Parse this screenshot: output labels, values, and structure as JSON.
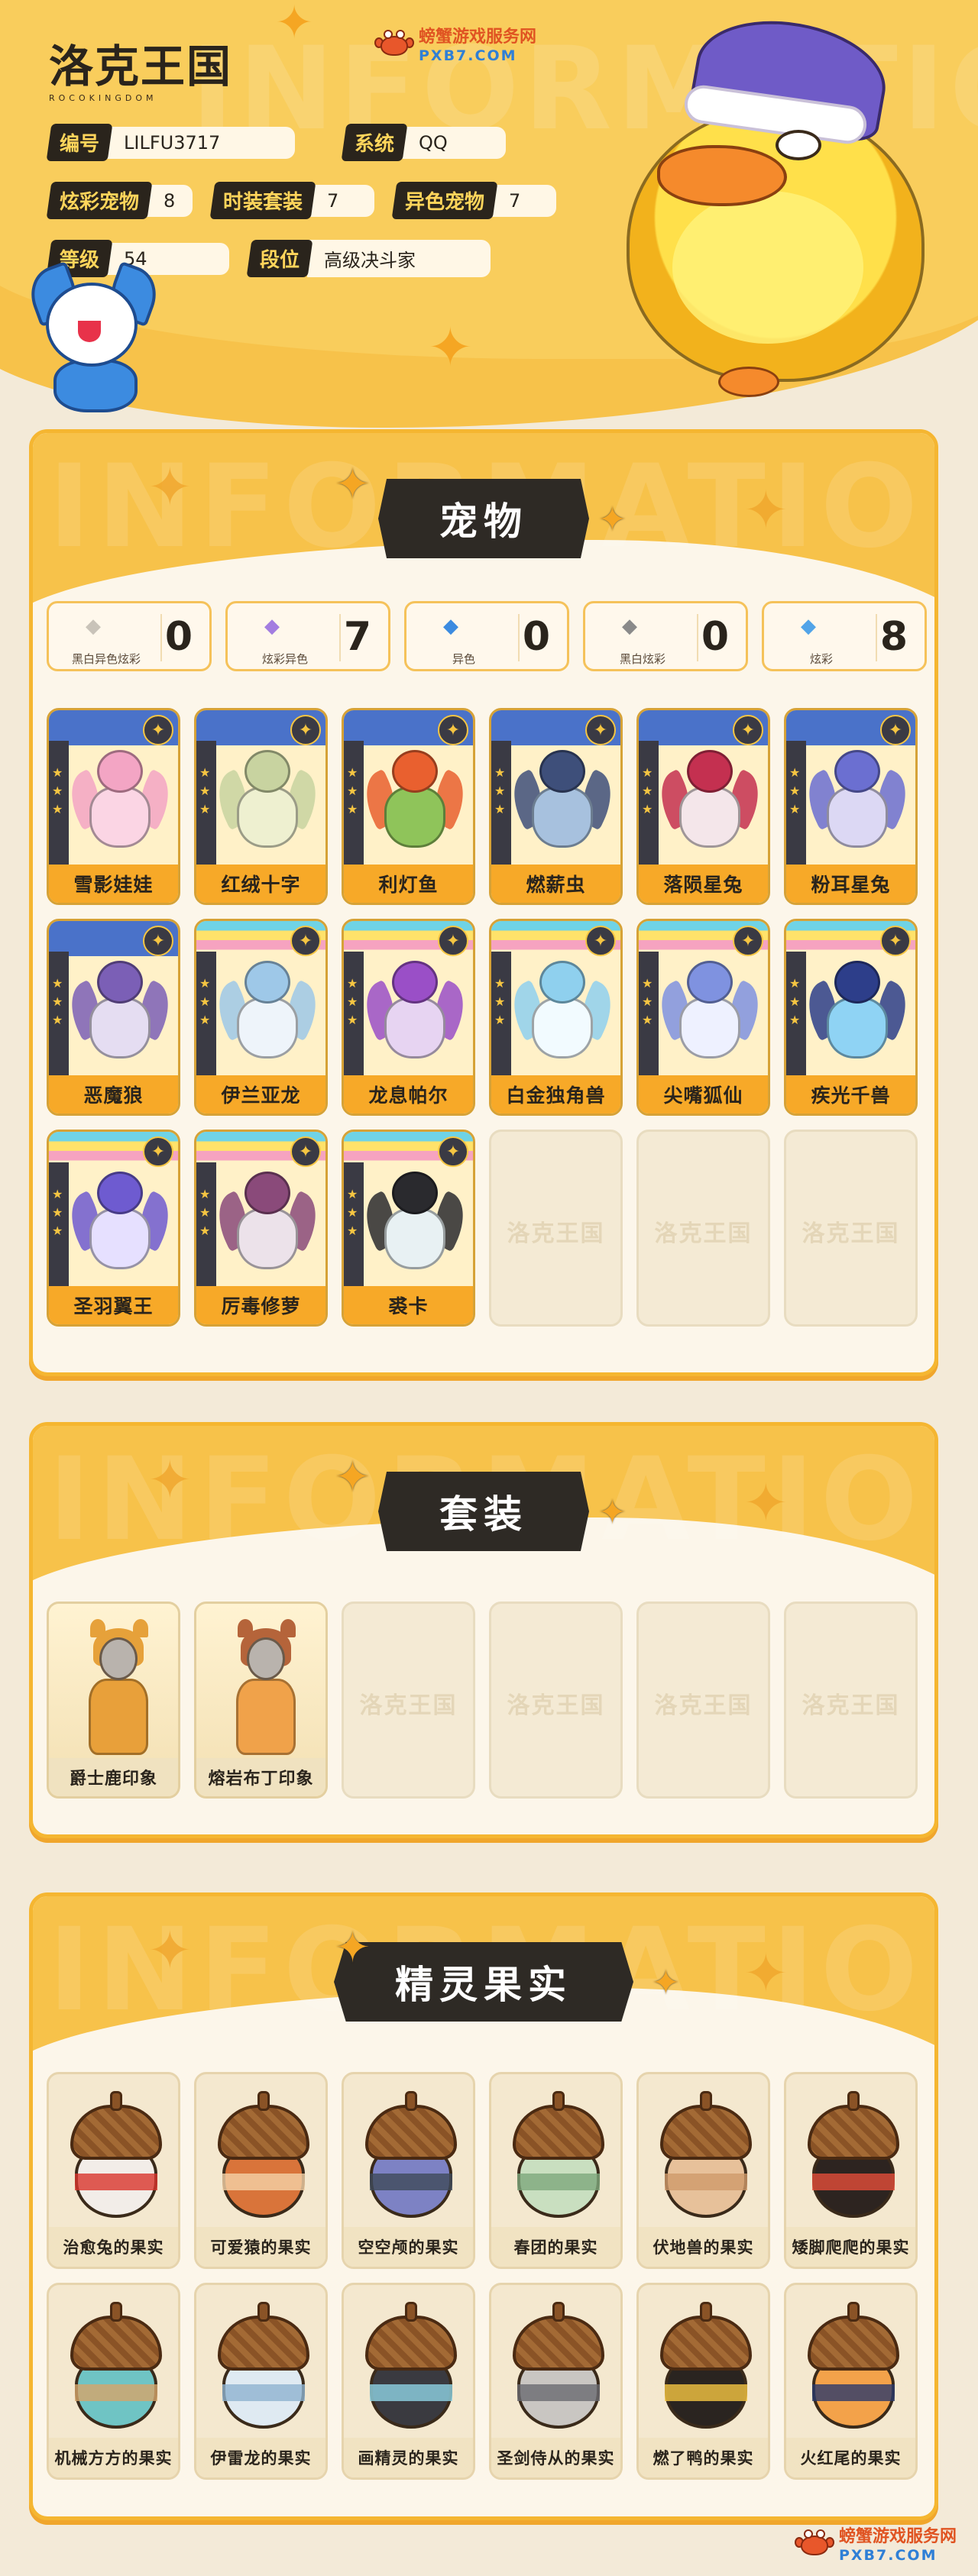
{
  "header": {
    "logo_main": "洛克王国",
    "logo_sub": "ROCOKINGDOM",
    "watermark": "INFORMATION",
    "service": {
      "name": "螃蟹游戏服务网",
      "domain": "PXB7.COM"
    },
    "fields": [
      {
        "label": "编号",
        "value": "LILFU3717"
      },
      {
        "label": "系统",
        "value": "QQ"
      },
      {
        "label": "炫彩宠物",
        "value": "8"
      },
      {
        "label": "时装套装",
        "value": "7"
      },
      {
        "label": "异色宠物",
        "value": "7"
      },
      {
        "label": "等级",
        "value": "54"
      },
      {
        "label": "段位",
        "value": "高级决斗家"
      }
    ]
  },
  "pets_section": {
    "title": "宠物",
    "watermark": "INFORMATION",
    "counters": [
      {
        "label": "黑白异色炫彩",
        "value": "0",
        "icon": "shard-icon",
        "color": "#c9c3b9"
      },
      {
        "label": "炫彩异色",
        "value": "7",
        "icon": "rainbow-shard-icon",
        "color": "#a37de0"
      },
      {
        "label": "异色",
        "value": "0",
        "icon": "blue-shard-icon",
        "color": "#3c8be0"
      },
      {
        "label": "黑白炫彩",
        "value": "0",
        "icon": "gray-shard-icon",
        "color": "#8a8a8a"
      },
      {
        "label": "炫彩",
        "value": "8",
        "icon": "star-icon",
        "color": "#52a4e8"
      }
    ],
    "pets": [
      {
        "name": "雪影娃娃",
        "frame": "blue",
        "c1": "#f3a5c4",
        "c2": "#fbd5e4"
      },
      {
        "name": "红绒十字",
        "frame": "blue",
        "c1": "#c8d3a0",
        "c2": "#eef0d0"
      },
      {
        "name": "利灯鱼",
        "frame": "blue",
        "c1": "#e9602f",
        "c2": "#8fc45a"
      },
      {
        "name": "燃薪虫",
        "frame": "blue",
        "c1": "#3e4f7a",
        "c2": "#a7c1de"
      },
      {
        "name": "落陨星兔",
        "frame": "blue",
        "c1": "#c43050",
        "c2": "#f4e6ea"
      },
      {
        "name": "粉耳星兔",
        "frame": "blue",
        "c1": "#6b6fd1",
        "c2": "#dcd8f4"
      },
      {
        "name": "恶魔狼",
        "frame": "blue",
        "c1": "#7b5fb6",
        "c2": "#e5ddf2"
      },
      {
        "name": "伊兰亚龙",
        "frame": "rainbow",
        "c1": "#9ec8e8",
        "c2": "#eef4fa"
      },
      {
        "name": "龙息帕尔",
        "frame": "rainbow",
        "c1": "#9a4fc7",
        "c2": "#e7d4f2"
      },
      {
        "name": "白金独角兽",
        "frame": "rainbow",
        "c1": "#8fd0ee",
        "c2": "#f2fbff"
      },
      {
        "name": "尖嘴狐仙",
        "frame": "rainbow",
        "c1": "#7f92e0",
        "c2": "#eef1ff"
      },
      {
        "name": "疾光千兽",
        "frame": "rainbow",
        "c1": "#2d3e8a",
        "c2": "#8fd3f4"
      },
      {
        "name": "圣羽翼王",
        "frame": "rainbow",
        "c1": "#6e5bd0",
        "c2": "#e6e0ff"
      },
      {
        "name": "厉毒修萝",
        "frame": "rainbow",
        "c1": "#8a4a7a",
        "c2": "#ece2ea"
      },
      {
        "name": "裘卡",
        "frame": "rainbow",
        "c1": "#2a2a2e",
        "c2": "#e8f1f3"
      }
    ],
    "empty_slots": 3,
    "empty_mark": "洛克王国"
  },
  "outfits_section": {
    "title": "套装",
    "watermark": "INFORMATION",
    "outfits": [
      {
        "name": "爵士鹿印象",
        "hair": "#e6a13a",
        "torso": "#e8a03a"
      },
      {
        "name": "熔岩布丁印象",
        "hair": "#b5643a",
        "torso": "#f0a24a"
      }
    ],
    "empty_slots": 4,
    "empty_mark": "洛克王国"
  },
  "fruits_section": {
    "title": "精灵果实",
    "watermark": "INFORMATION",
    "fruits": [
      {
        "name": "治愈兔的果实",
        "body": "#f2ede8",
        "band": "#d8342c"
      },
      {
        "name": "可爱猿的果实",
        "body": "#d9743a",
        "band": "#f4d2a8"
      },
      {
        "name": "空空颅的果实",
        "body": "#7d82c4",
        "band": "#3e4a5a"
      },
      {
        "name": "春团的果实",
        "body": "#c9dfc0",
        "band": "#7ea77c"
      },
      {
        "name": "伏地兽的果实",
        "body": "#e7c19a",
        "band": "#cf9a6a"
      },
      {
        "name": "矮脚爬爬的果实",
        "body": "#2d2420",
        "band": "#e34d3a"
      },
      {
        "name": "机械方方的果实",
        "body": "#6fc4c4",
        "band": "#d6a56a"
      },
      {
        "name": "伊雷龙的果实",
        "body": "#dfeaf2",
        "band": "#8fb3cf"
      },
      {
        "name": "画精灵的果实",
        "body": "#3a3a40",
        "band": "#8fd3e4"
      },
      {
        "name": "圣剑侍从的果实",
        "body": "#c9c6c2",
        "band": "#6a6a70"
      },
      {
        "name": "燃了鸭的果实",
        "body": "#2a2420",
        "band": "#f5c642"
      },
      {
        "name": "火红尾的果实",
        "body": "#f3a24a",
        "band": "#2a3a6a"
      }
    ]
  },
  "footer": {
    "service": "螃蟹游戏服务网",
    "domain": "PXB7.COM"
  },
  "colors": {
    "accent": "#f7c24a",
    "dark": "#2e2a25",
    "orange": "#f7a928"
  }
}
